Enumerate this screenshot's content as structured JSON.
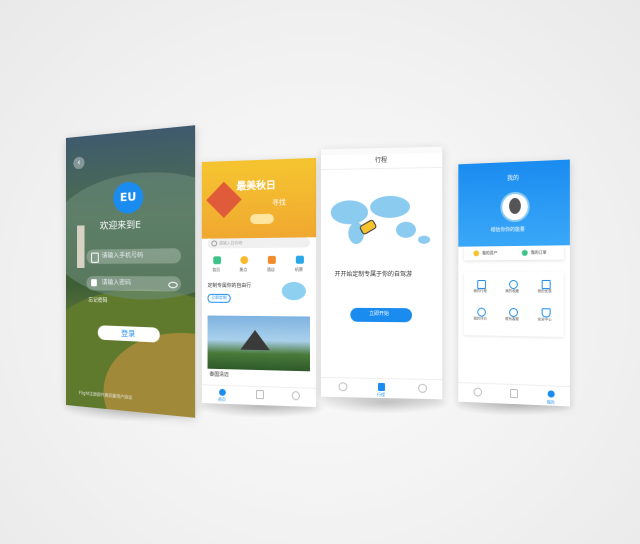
{
  "login": {
    "logo": "EU",
    "welcome": "欢迎来到E",
    "phone_placeholder": "请输入手机号码",
    "password_placeholder": "请输入密码",
    "forgot": "忘记密码",
    "submit": "登录",
    "agreement": "Flight注册即代表同意用户协议"
  },
  "home": {
    "banner_title": "最美秋日",
    "banner_subtitle": "寻找",
    "search_placeholder": "请输入目的地",
    "categories": [
      "首页",
      "景点",
      "酒店",
      "机票"
    ],
    "promo": "定制专属你的自由行",
    "promo_button": "立即定制",
    "card_title": "泰国清迈",
    "tab_label": "首页"
  },
  "plan": {
    "title": "行程",
    "tagline": "开开始定制专属于你的自驾游",
    "button": "立即开始",
    "tab_label": "行程"
  },
  "profile": {
    "title": "我的",
    "name": "相信你你的能量",
    "stats": [
      "我的资产",
      "我的订单"
    ],
    "grid": [
      "我的行程",
      "我的收藏",
      "我的优惠",
      "我的评价",
      "联系客服",
      "安全中心"
    ],
    "tab_label": "我的"
  },
  "colors": {
    "primary": "#1a8cf0",
    "banner": "#f5c230"
  }
}
